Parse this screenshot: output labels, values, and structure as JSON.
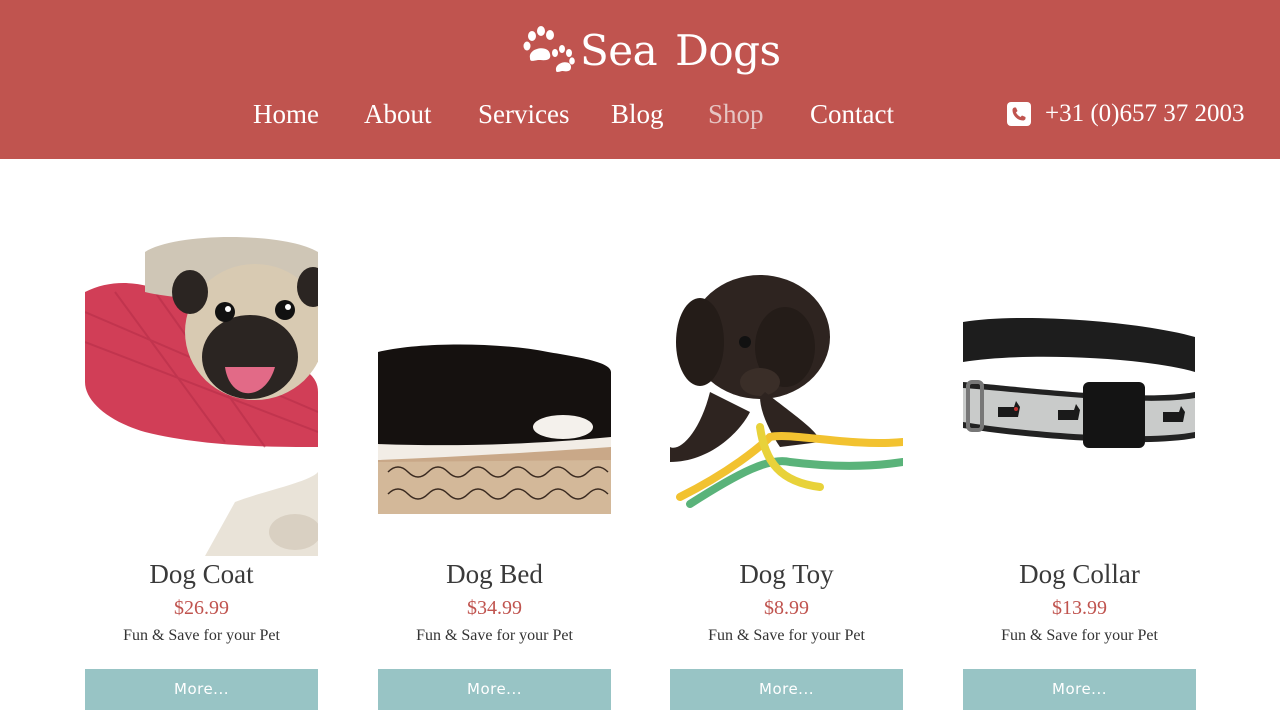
{
  "brand": {
    "name_part1": "Sea",
    "name_part2": "Dogs",
    "logo_icon": "paw-prints-icon",
    "color": "#c0544f"
  },
  "nav": {
    "items": [
      {
        "label": "Home",
        "active": false
      },
      {
        "label": "About",
        "active": false
      },
      {
        "label": "Services",
        "active": false
      },
      {
        "label": "Blog",
        "active": false
      },
      {
        "label": "Shop",
        "active": true
      },
      {
        "label": "Contact",
        "active": false
      }
    ]
  },
  "contact": {
    "phone_icon": "phone-icon",
    "phone": "+31 (0)657 37 2003"
  },
  "products": [
    {
      "name": "Dog Coat",
      "price": "$26.99",
      "tagline": "Fun & Save for your Pet",
      "button": "More...",
      "image": "pug-in-red-coat"
    },
    {
      "name": "Dog Bed",
      "price": "$34.99",
      "tagline": "Fun & Save for your Pet",
      "button": "More...",
      "image": "dog-sleeping-in-bed"
    },
    {
      "name": "Dog Toy",
      "price": "$8.99",
      "tagline": "Fun & Save for your Pet",
      "button": "More...",
      "image": "puppy-with-rope-toy"
    },
    {
      "name": "Dog Collar",
      "price": "$13.99",
      "tagline": "Fun & Save for your Pet",
      "button": "More...",
      "image": "dog-collar"
    }
  ],
  "colors": {
    "header_bg": "#c0544f",
    "accent_price": "#c0544f",
    "button_bg": "#98c4c5",
    "active_nav": "#e6c5c3"
  }
}
